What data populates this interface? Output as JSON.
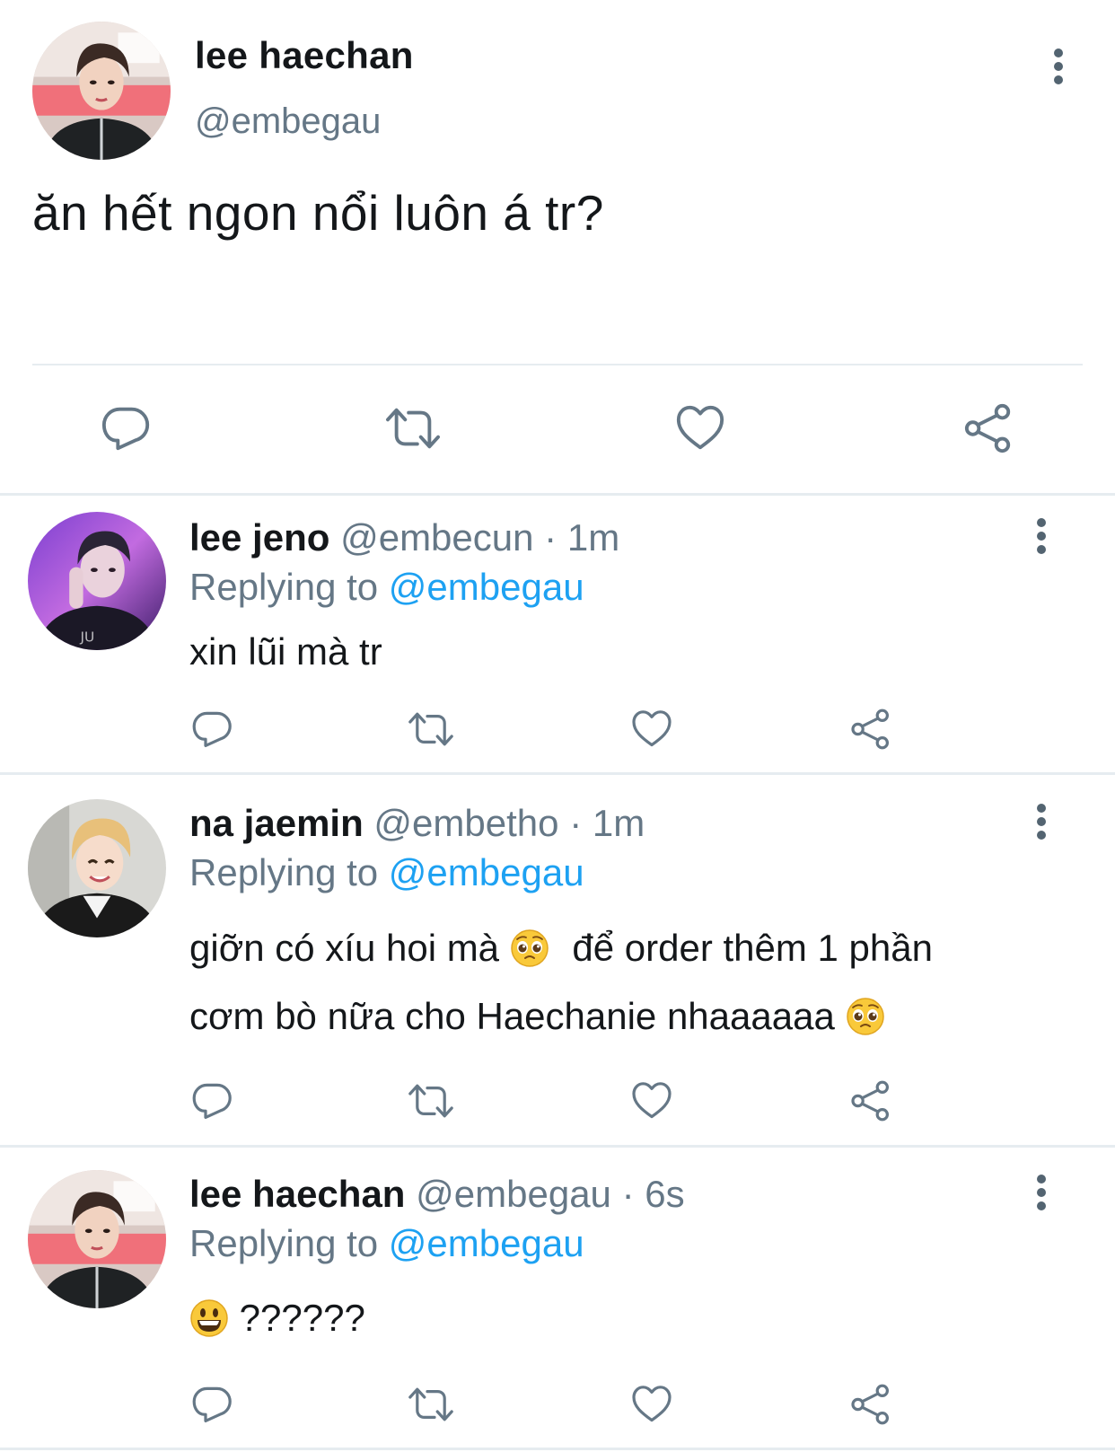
{
  "main_tweet": {
    "name": "lee haechan",
    "handle": "@embegau",
    "text": "ăn hết ngon nổi luôn á tr?"
  },
  "replies": [
    {
      "name": "lee jeno",
      "handle": "@embecun",
      "time": "1m",
      "replying_label": "Replying to",
      "replying_handle": "@embegau",
      "text": "xin lũi mà tr"
    },
    {
      "name": "na jaemin",
      "handle": "@embetho",
      "time": "1m",
      "replying_label": "Replying to",
      "replying_handle": "@embegau",
      "text_line1_a": "giỡn có xíu hoi mà",
      "text_line1_b": "để order thêm 1 phần",
      "text_line2": "cơm bò nữa cho Haechanie nhaaaaaa"
    },
    {
      "name": "lee haechan",
      "handle": "@embegau",
      "time": "6s",
      "replying_label": "Replying to",
      "replying_handle": "@embegau",
      "text": "??????"
    }
  ],
  "separator": "·",
  "icons": [
    "more-vertical-icon",
    "reply-icon",
    "retweet-icon",
    "like-icon",
    "share-icon",
    "pleading-face-emoji",
    "smiley-emoji"
  ],
  "colors": {
    "text": "#14171a",
    "secondary": "#657786",
    "link": "#1da1f2",
    "icon": "#657786",
    "divider": "#e6ecf0"
  }
}
